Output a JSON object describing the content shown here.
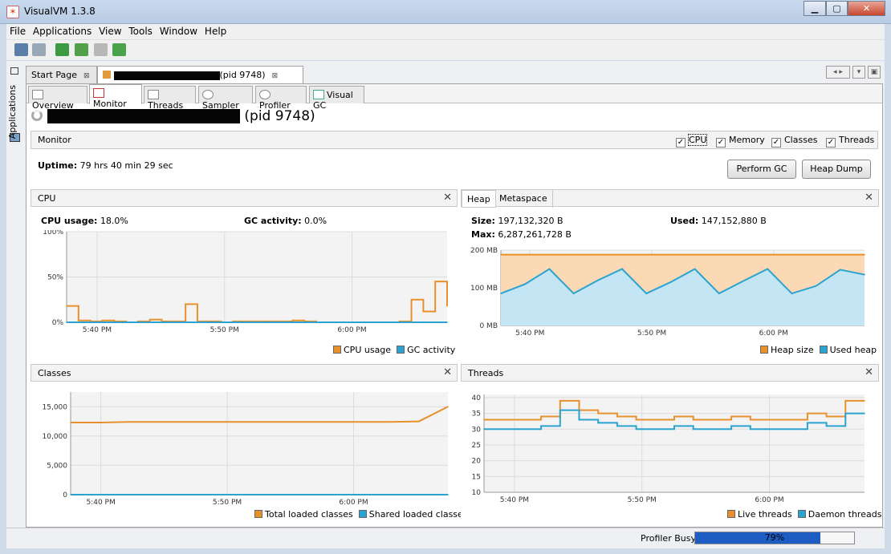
{
  "window": {
    "title": "VisualVM 1.3.8",
    "min": "▁",
    "max": "▢",
    "close": "✕"
  },
  "menu": [
    "File",
    "Applications",
    "View",
    "Tools",
    "Window",
    "Help"
  ],
  "sidebar": {
    "label": "Applications"
  },
  "doc_tabs": [
    {
      "label": "Start Page"
    },
    {
      "label": "(pid 9748)"
    }
  ],
  "sub_tabs": [
    "Overview",
    "Monitor",
    "Threads",
    "Sampler",
    "Profiler",
    "Visual GC"
  ],
  "header": {
    "title": "(pid 9748)"
  },
  "monitor": {
    "label": "Monitor",
    "checks": [
      "CPU",
      "Memory",
      "Classes",
      "Threads"
    ],
    "uptime_label": "Uptime:",
    "uptime_value": "79 hrs 40 min 29 sec",
    "perform_gc": "Perform GC",
    "heap_dump": "Heap Dump"
  },
  "cpu_panel": {
    "title": "CPU",
    "usage_label": "CPU usage:",
    "usage_value": "18.0%",
    "gc_label": "GC activity:",
    "gc_value": "0.0%",
    "legend": [
      "CPU usage",
      "GC activity"
    ]
  },
  "heap_panel": {
    "tabs": [
      "Heap",
      "Metaspace"
    ],
    "size_label": "Size:",
    "size_value": "197,132,320 B",
    "used_label": "Used:",
    "used_value": "147,152,880 B",
    "max_label": "Max:",
    "max_value": "6,287,261,728 B",
    "legend": [
      "Heap size",
      "Used heap"
    ]
  },
  "classes_panel": {
    "title": "Classes",
    "legend": [
      "Total loaded classes",
      "Shared loaded classes"
    ]
  },
  "threads_panel": {
    "title": "Threads",
    "legend": [
      "Live threads",
      "Daemon threads"
    ]
  },
  "status": {
    "busy_label": "Profiler Busy",
    "progress": 0.79,
    "progress_text": "79%"
  },
  "colors": {
    "orange": "#e8912c",
    "blue": "#2aa3d0",
    "heap_fill": "#fbd9b4",
    "used_fill": "#c4e6f4"
  },
  "chart_data": [
    {
      "type": "line",
      "title": "CPU",
      "x_ticks": [
        "5:40 PM",
        "5:50 PM",
        "6:00 PM"
      ],
      "y_ticks": [
        "100%",
        "50%",
        "0%"
      ],
      "ylim": [
        0,
        100
      ],
      "series": [
        {
          "name": "CPU usage",
          "values": [
            18,
            2,
            1,
            2,
            1,
            0,
            1,
            3,
            1,
            1,
            20,
            1,
            1,
            0,
            1,
            1,
            1,
            1,
            1,
            2,
            1,
            0,
            0,
            0,
            0,
            0,
            0,
            0,
            1,
            25,
            12,
            45,
            18
          ]
        },
        {
          "name": "GC activity",
          "values": [
            0,
            0,
            0,
            0,
            0,
            0,
            0,
            0,
            0,
            0,
            0,
            0,
            0,
            0,
            0,
            0,
            0,
            0,
            0,
            0,
            0,
            0,
            0,
            0,
            0,
            0,
            0,
            0,
            0,
            0,
            0,
            0,
            0
          ]
        }
      ]
    },
    {
      "type": "area",
      "title": "Heap",
      "x_ticks": [
        "5:40 PM",
        "5:50 PM",
        "6:00 PM"
      ],
      "y_ticks": [
        "200 MB",
        "100 MB",
        "0 MB"
      ],
      "ylim": [
        0,
        200
      ],
      "series": [
        {
          "name": "Heap size",
          "values": [
            188,
            188,
            188,
            188,
            188,
            188,
            188,
            188,
            188,
            188,
            188,
            188,
            188,
            188,
            188,
            188
          ]
        },
        {
          "name": "Used heap",
          "values": [
            85,
            110,
            150,
            85,
            120,
            150,
            85,
            115,
            150,
            85,
            118,
            150,
            85,
            105,
            148,
            135
          ]
        }
      ]
    },
    {
      "type": "line",
      "title": "Classes",
      "x_ticks": [
        "5:40 PM",
        "5:50 PM",
        "6:00 PM"
      ],
      "y_ticks": [
        "15,000",
        "10,000",
        "5,000",
        "0"
      ],
      "ylim": [
        0,
        17500
      ],
      "series": [
        {
          "name": "Total loaded classes",
          "values": [
            12300,
            12300,
            12400,
            12400,
            12400,
            12400,
            12400,
            12400,
            12400,
            12400,
            12400,
            12400,
            12500,
            15000
          ]
        },
        {
          "name": "Shared loaded classes",
          "values": [
            0,
            0,
            0,
            0,
            0,
            0,
            0,
            0,
            0,
            0,
            0,
            0,
            0,
            0
          ]
        }
      ]
    },
    {
      "type": "line",
      "title": "Threads",
      "x_ticks": [
        "5:40 PM",
        "5:50 PM",
        "6:00 PM"
      ],
      "y_ticks": [
        "40",
        "35",
        "30",
        "25",
        "20",
        "15",
        "10"
      ],
      "ylim": [
        10,
        41
      ],
      "series": [
        {
          "name": "Live threads",
          "values": [
            33,
            33,
            33,
            34,
            39,
            36,
            35,
            34,
            33,
            33,
            34,
            33,
            33,
            34,
            33,
            33,
            33,
            35,
            34,
            39,
            39
          ]
        },
        {
          "name": "Daemon threads",
          "values": [
            30,
            30,
            30,
            31,
            36,
            33,
            32,
            31,
            30,
            30,
            31,
            30,
            30,
            31,
            30,
            30,
            30,
            32,
            31,
            35,
            35
          ]
        }
      ]
    }
  ]
}
